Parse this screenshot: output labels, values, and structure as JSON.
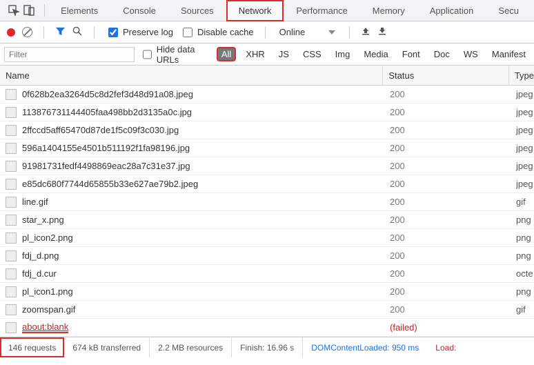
{
  "tabs": {
    "elements": "Elements",
    "console": "Console",
    "sources": "Sources",
    "network": "Network",
    "performance": "Performance",
    "memory": "Memory",
    "application": "Application",
    "security": "Secu"
  },
  "toolbar": {
    "preserve_log": "Preserve log",
    "disable_cache": "Disable cache",
    "throttling": "Online"
  },
  "filter": {
    "placeholder": "Filter",
    "hide_urls": "Hide data URLs",
    "chips": {
      "all": "All",
      "xhr": "XHR",
      "js": "JS",
      "css": "CSS",
      "img": "Img",
      "media": "Media",
      "font": "Font",
      "doc": "Doc",
      "ws": "WS",
      "manifest": "Manifest"
    }
  },
  "columns": {
    "name": "Name",
    "status": "Status",
    "type": "Type"
  },
  "rows": [
    {
      "name": "0f628b2ea3264d5c8d2fef3d48d91a08.jpeg",
      "status": "200",
      "type": "jpeg"
    },
    {
      "name": "113876731144405faa498bb2d3135a0c.jpg",
      "status": "200",
      "type": "jpeg"
    },
    {
      "name": "2ffccd5aff65470d87de1f5c09f3c030.jpg",
      "status": "200",
      "type": "jpeg"
    },
    {
      "name": "596a1404155e4501b511192f1fa98196.jpg",
      "status": "200",
      "type": "jpeg"
    },
    {
      "name": "91981731fedf4498869eac28a7c31e37.jpg",
      "status": "200",
      "type": "jpeg"
    },
    {
      "name": "e85dc680f7744d65855b33e627ae79b2.jpeg",
      "status": "200",
      "type": "jpeg"
    },
    {
      "name": "line.gif",
      "status": "200",
      "type": "gif"
    },
    {
      "name": "star_x.png",
      "status": "200",
      "type": "png"
    },
    {
      "name": "pl_icon2.png",
      "status": "200",
      "type": "png"
    },
    {
      "name": "fdj_d.png",
      "status": "200",
      "type": "png"
    },
    {
      "name": "fdj_d.cur",
      "status": "200",
      "type": "octe"
    },
    {
      "name": "pl_icon1.png",
      "status": "200",
      "type": "png"
    },
    {
      "name": "zoomspan.gif",
      "status": "200",
      "type": "gif"
    },
    {
      "name": "about:blank",
      "status": "(failed)",
      "type": ""
    }
  ],
  "statusbar": {
    "requests": "146 requests",
    "transferred": "674 kB transferred",
    "resources": "2.2 MB resources",
    "finish": "Finish: 16.96 s",
    "dom": "DOMContentLoaded: 950 ms",
    "load": "Load:"
  }
}
